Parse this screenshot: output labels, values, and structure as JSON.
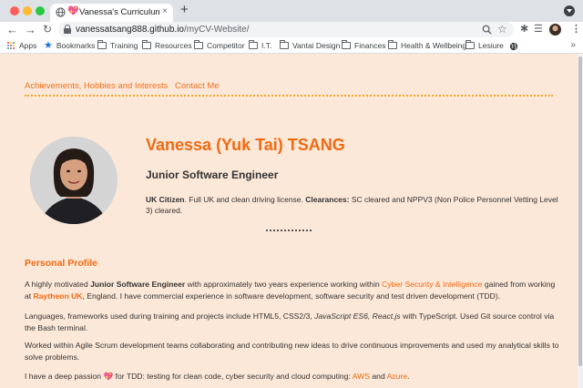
{
  "browser": {
    "tab_title": "Vanessa's Curriculum Vitae",
    "tab_close": "×",
    "new_tab": "+",
    "nav": {
      "back": "←",
      "forward": "→",
      "reload": "↻"
    },
    "url_host": "vanessatsang888.github.io",
    "url_path": "/myCV-Website/",
    "bookmarks_more": "»",
    "bookmarks": [
      {
        "label": "Apps",
        "icon": "apps-grid-icon"
      },
      {
        "label": "Bookmarks",
        "icon": "star-icon"
      },
      {
        "label": "Training",
        "icon": "folder-icon"
      },
      {
        "label": "Resources",
        "icon": "folder-icon"
      },
      {
        "label": "Competitor",
        "icon": "folder-icon"
      },
      {
        "label": "I.T.",
        "icon": "folder-icon"
      },
      {
        "label": "Vantai Design",
        "icon": "folder-icon"
      },
      {
        "label": "Finances",
        "icon": "folder-icon"
      },
      {
        "label": "Health & Wellbeing",
        "icon": "folder-icon"
      },
      {
        "label": "Lesiure",
        "icon": "folder-icon"
      }
    ]
  },
  "page": {
    "nav": [
      "Achievements, Hobbies and Interests",
      "Contact Me"
    ],
    "name": "Vanessa (Yuk Tai) TSANG",
    "role": "Junior Software Engineer",
    "clearance": {
      "citizen_label": "UK Citizen",
      "citizen_text": ". Full UK and clean driving license. ",
      "clearances_label": "Clearances:",
      "clearances_text": " SC cleared and NPPV3 (Non Police Personnel Vetting Level 3) cleared."
    },
    "profile": {
      "title": "Personal Profile",
      "p1": {
        "a": "A highly motivated ",
        "b": "Junior Software Engineer",
        "c": " with approximately two years experience working within ",
        "link": "Cyber Security & Intelligence",
        "d": " gained from working at ",
        "company": "Raytheon UK",
        "e": ", England. I have commercial experience in software development, software security and test driven development (TDD)."
      },
      "p2": {
        "a": "Languages, frameworks used during training and projects include HTML5, CSS2/3, ",
        "i": "JavaScript ES6, React.js",
        "b": " with TypeScript. Used Git source control via the Bash terminal."
      },
      "p3": "Worked within Agile Scrum development teams collaborating and contributing new ideas to drive continuous improvements and used my analytical skills to solve problems.",
      "p4": {
        "a": "I have a deep passion ",
        "heart": "💖",
        "b": " for TDD: testing for clean code, cyber security and cloud computing: ",
        "aws": "AWS",
        "and": " and ",
        "azure": "Azure",
        "end": "."
      }
    }
  },
  "colors": {
    "accent": "#f06a12",
    "background": "#fce8d8",
    "heart": "#e94cc4"
  }
}
